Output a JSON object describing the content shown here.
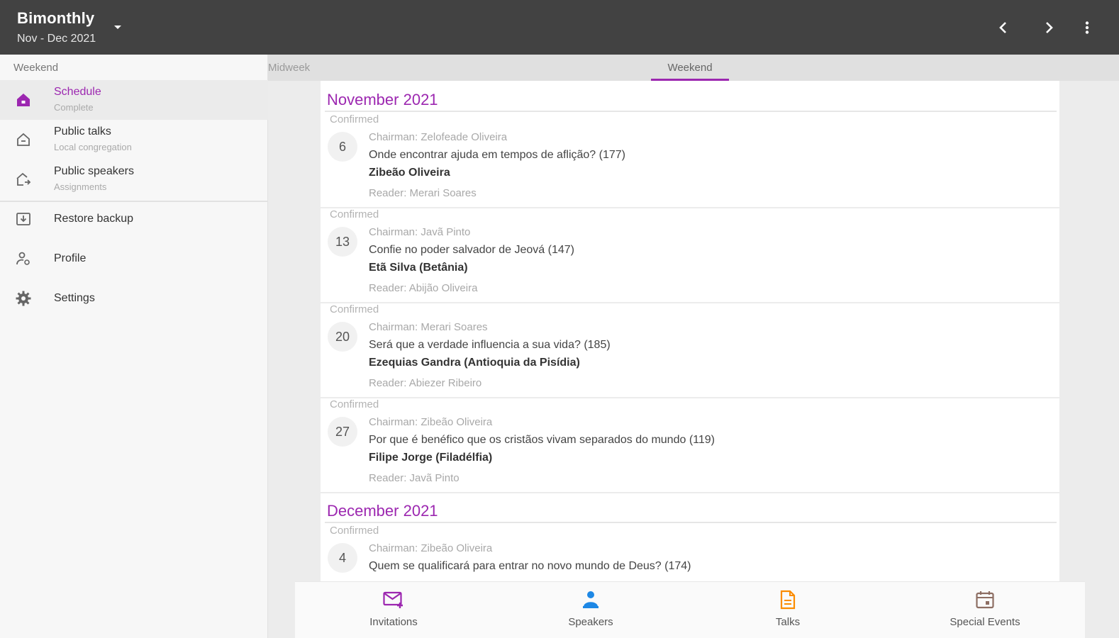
{
  "appbar": {
    "title": "Bimonthly",
    "subtitle": "Nov - Dec 2021",
    "icons": {
      "dropdown": "caret-down-icon",
      "prev": "chevron-left-icon",
      "next": "chevron-right-icon",
      "more": "more-vert-icon"
    }
  },
  "sidebar": {
    "section_title": "Weekend",
    "items": [
      {
        "label": "Schedule",
        "sublabel": "Complete",
        "icon": "home-icon",
        "active": true
      },
      {
        "label": "Public talks",
        "sublabel": "Local congregation",
        "icon": "home-outline-icon"
      },
      {
        "label": "Public speakers",
        "sublabel": "Assignments",
        "icon": "speaker-outbound-icon"
      },
      {
        "label": "Restore backup",
        "icon": "restore-icon"
      },
      {
        "label": "Profile",
        "icon": "profile-icon"
      },
      {
        "label": "Settings",
        "icon": "gear-icon"
      }
    ]
  },
  "tabs": [
    {
      "label": "Midweek"
    },
    {
      "label": "Weekend",
      "active": true
    }
  ],
  "months": [
    {
      "title": "November 2021",
      "weeks": [
        {
          "status": "Confirmed",
          "day": "6",
          "chairman": "Chairman: Zelofeade Oliveira",
          "talk": "Onde encontrar ajuda em tempos de aflição? (177)",
          "speaker": "Zibeão Oliveira",
          "reader": "Reader: Merari Soares"
        },
        {
          "status": "Confirmed",
          "day": "13",
          "chairman": "Chairman: Javã Pinto",
          "talk": "Confie no poder salvador de Jeová (147)",
          "speaker": "Etã Silva (Betânia)",
          "reader": "Reader: Abijão Oliveira"
        },
        {
          "status": "Confirmed",
          "day": "20",
          "chairman": "Chairman: Merari Soares",
          "talk": "Será que a verdade influencia a sua vida? (185)",
          "speaker": "Ezequias Gandra (Antioquia da Pisídia)",
          "reader": "Reader: Abiezer Ribeiro"
        },
        {
          "status": "Confirmed",
          "day": "27",
          "chairman": "Chairman: Zibeão Oliveira",
          "talk": "Por que é benéfico que os cristãos vivam separados do mundo (119)",
          "speaker": "Filipe Jorge (Filadélfia)",
          "reader": "Reader: Javã Pinto"
        }
      ]
    },
    {
      "title": "December 2021",
      "weeks": [
        {
          "status": "Confirmed",
          "day": "4",
          "chairman": "Chairman: Zibeão Oliveira",
          "talk": "Quem se qualificará para entrar no novo mundo de Deus? (174)"
        }
      ]
    }
  ],
  "bottom_nav": [
    {
      "label": "Invitations",
      "icon": "mail-plus-icon",
      "color": "#9c27b0"
    },
    {
      "label": "Speakers",
      "icon": "speaker-person-icon",
      "color": "#1e88e5"
    },
    {
      "label": "Talks",
      "icon": "document-icon",
      "color": "#fb8c00"
    },
    {
      "label": "Special Events",
      "icon": "calendar-icon",
      "color": "#8d6e63"
    }
  ],
  "colors": {
    "accent": "#9c27b0",
    "appbar": "#424242"
  }
}
